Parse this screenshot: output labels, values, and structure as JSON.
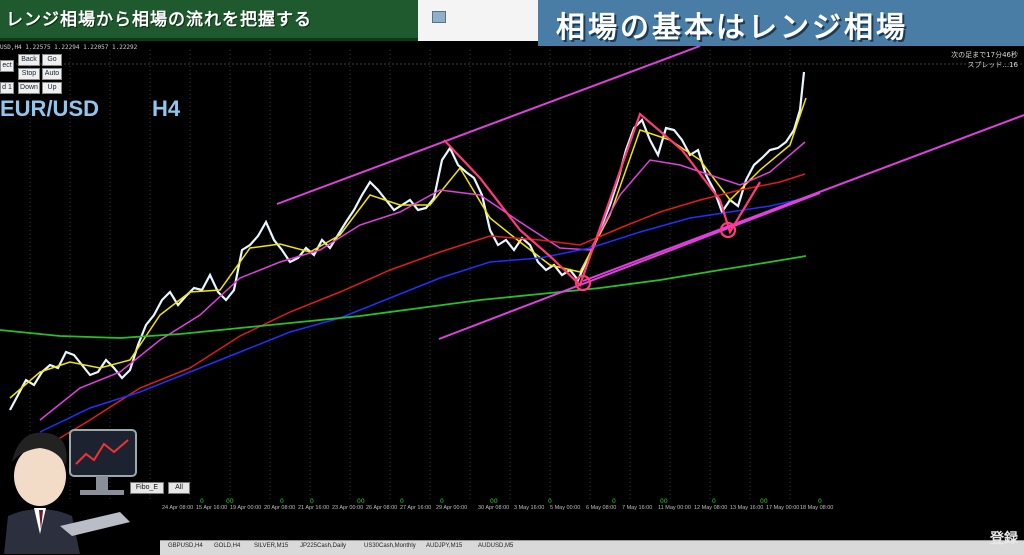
{
  "banner": {
    "text": "レンジ相場から相場の流れを把握する"
  },
  "headline": {
    "text": "相場の基本はレンジ相場"
  },
  "chart_header": {
    "info": "USD,H4  1.22575 1.22294 1.22057 1.22292",
    "symbol": "EUR/USD",
    "timeframe": "H4",
    "jp_info_1": "次の足まで17分46秒",
    "jp_info_2": "スプレッド...16"
  },
  "panel": {
    "buttons": [
      {
        "label": "ect"
      },
      {
        "label": "Back"
      },
      {
        "label": "Go"
      },
      {
        "label": "Stop"
      },
      {
        "label": "Auto"
      },
      {
        "label": "d 1"
      },
      {
        "label": "Down"
      },
      {
        "label": "Up"
      }
    ]
  },
  "bottom_buttons": {
    "fibo": "Fibo_E",
    "all": "All"
  },
  "x_axis": {
    "ticks": [
      "24 Apr 08:00",
      "15 Apr 16:00",
      "19 Apr 00:00",
      "20 Apr 08:00",
      "21 Apr 16:00",
      "23 Apr 00:00",
      "26 Apr 08:00",
      "27 Apr 16:00",
      "29 Apr 00:00",
      "30 Apr 08:00",
      "3 May 16:00",
      "5 May 00:00",
      "6 May 08:00",
      "7 May 16:00",
      "11 May 00:00",
      "12 May 08:00",
      "13 May 16:00",
      "17 May 00:00",
      "18 May 08:00"
    ]
  },
  "tabs": [
    "GBPUSD,H4",
    "GOLD,H4",
    "SILVER,M15",
    "JP225Cash,Daily",
    "US30Cash,Monthly",
    "AUDJPY,M15",
    "AUDUSD,M5"
  ],
  "badge": "登録",
  "colors": {
    "banner_bg": "#1f5a2e",
    "headline_bg": "#4a7da6",
    "ma_yellow": "#f2e600",
    "ma_magenta": "#e040e0",
    "ma_red": "#e21c1c",
    "ma_blue": "#2030ff",
    "ma_green": "#28c028",
    "channel": "#e040e0",
    "annotation": "#ff3c78",
    "candle": "#e8f6ff"
  }
}
